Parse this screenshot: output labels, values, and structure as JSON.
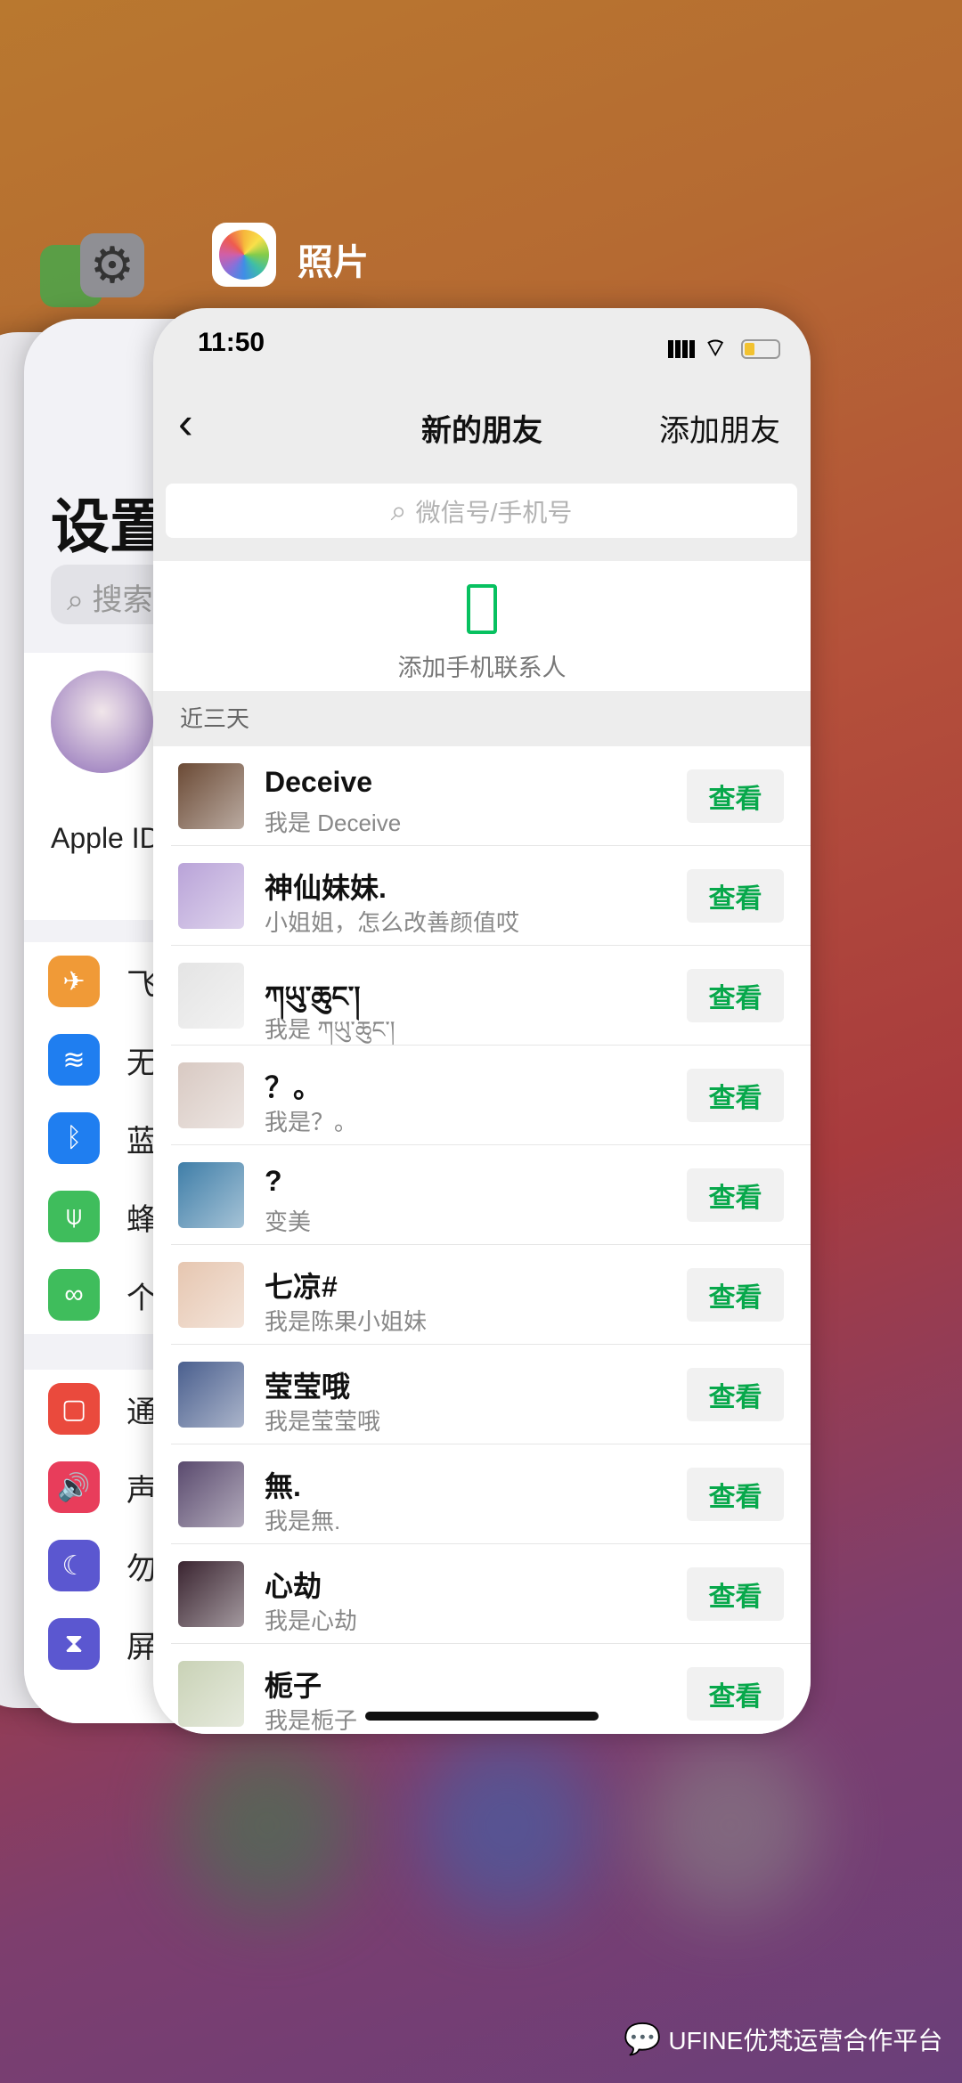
{
  "switcher": {
    "front_app_label": "照片"
  },
  "settings": {
    "title": "设置",
    "search_placeholder": "搜索",
    "apple_id": "Apple ID",
    "group1": [
      {
        "label": "飞",
        "icon": "airplane-icon",
        "color": "#f09a37"
      },
      {
        "label": "无",
        "icon": "wifi-icon",
        "color": "#1f7ef0"
      },
      {
        "label": "蓝",
        "icon": "bluetooth-icon",
        "color": "#1f7ef0"
      },
      {
        "label": "蜂",
        "icon": "cellular-icon",
        "color": "#3fbd5c"
      },
      {
        "label": "个",
        "icon": "hotspot-icon",
        "color": "#3fbd5c"
      }
    ],
    "group2": [
      {
        "label": "通",
        "icon": "notifications-icon",
        "color": "#ea4a3d"
      },
      {
        "label": "声",
        "icon": "sound-icon",
        "color": "#e83d5b"
      },
      {
        "label": "勿",
        "icon": "moon-icon",
        "color": "#5b57d0"
      },
      {
        "label": "屏",
        "icon": "hourglass-icon",
        "color": "#5b57d0"
      }
    ]
  },
  "wechat": {
    "status_time": "11:50",
    "nav": {
      "title": "新的朋友",
      "right_action": "添加朋友"
    },
    "search_placeholder": "微信号/手机号",
    "add_phone_contacts": "添加手机联系人",
    "section_header": "近三天",
    "view_label": "查看",
    "accent": "#07a84b",
    "contacts": [
      {
        "name": "Deceive",
        "message": "我是 Deceive",
        "avatar_color": "#6b4a35"
      },
      {
        "name": "神仙妹妹.",
        "message": "小姐姐，怎么改善颜值哎",
        "avatar_color": "#b9a3d8"
      },
      {
        "name": "ཀཡུ་ཆུང་།",
        "message": "我是 ཀཡུ་ཆུང་།",
        "avatar_color": "#e4e4e4"
      },
      {
        "name": "？。",
        "message": "我是？。",
        "avatar_color": "#d8c9c2"
      },
      {
        "name": "?",
        "message": "变美",
        "avatar_color": "#3f7ea8"
      },
      {
        "name": "七凉#",
        "message": "我是陈果小姐妹",
        "avatar_color": "#e6c6b0"
      },
      {
        "name": "莹莹哦",
        "message": "我是莹莹哦",
        "avatar_color": "#4a5f8e"
      },
      {
        "name": "無.",
        "message": "我是無.",
        "avatar_color": "#5a4a6e"
      },
      {
        "name": "心劫",
        "message": "我是心劫",
        "avatar_color": "#3a2430"
      },
      {
        "name": "栀子",
        "message": "我是栀子",
        "avatar_color": "#c9d2b6"
      }
    ]
  },
  "watermark": "UFINE优梵运营合作平台"
}
